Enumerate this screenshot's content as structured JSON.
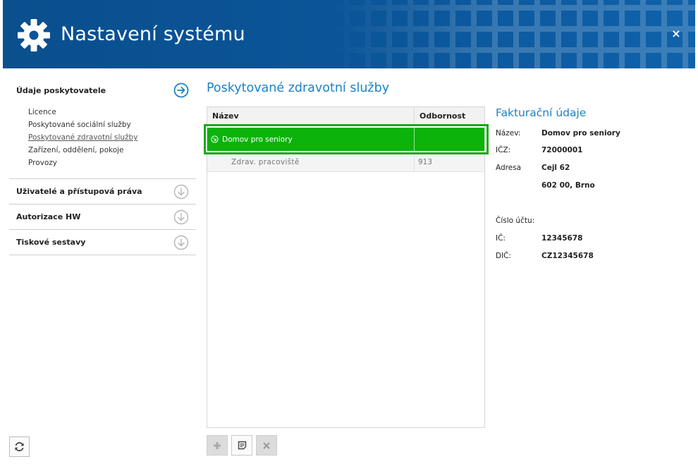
{
  "window": {
    "title": "Nastavení systému",
    "close_glyph": "×"
  },
  "colors": {
    "header": "#0b5599",
    "accent": "#1c82c5",
    "selection": "#0bb30b"
  },
  "sidebar": {
    "section_provider": {
      "label": "Údaje poskytovatele",
      "icon": "arrow-right-circle-icon",
      "items": [
        {
          "label": "Licence"
        },
        {
          "label": "Poskytované sociální služby"
        },
        {
          "label": "Poskytované zdravotní služby"
        },
        {
          "label": "Zařízení, oddělení, pokoje"
        },
        {
          "label": "Provozy"
        }
      ]
    },
    "section_users": {
      "label": "Uživatelé a přístupová práva",
      "icon": "arrow-down-circle-icon"
    },
    "section_hw": {
      "label": "Autorizace HW",
      "icon": "arrow-down-circle-icon"
    },
    "section_print": {
      "label": "Tiskové sestavy",
      "icon": "arrow-down-circle-icon"
    }
  },
  "main": {
    "title": "Poskytované zdravotní služby",
    "columns": {
      "name": "Název",
      "specialty": "Odbornost"
    },
    "selected_row": {
      "name": "Domov pro seniory",
      "specialty": ""
    },
    "sub_row": {
      "name": "Zdrav. pracoviště",
      "specialty": "913"
    },
    "toolbar": {
      "add_icon": "plus-icon",
      "edit_icon": "note-icon",
      "delete_icon": "close-icon"
    }
  },
  "invoice": {
    "title": "Fakturační údaje",
    "name_label": "Název:",
    "name_value": "Domov pro seniory",
    "icz_label": "IČZ:",
    "icz_value": "72000001",
    "address_label": "Adresa",
    "address_line1": "Cejl 62",
    "address_line2": "602 00, Brno",
    "account_label": "Číslo účtu:",
    "ic_label": "IČ:",
    "ic_value": "12345678",
    "dic_label": "DIČ:",
    "dic_value": "CZ12345678"
  },
  "footer": {
    "refresh_icon": "refresh-icon"
  }
}
